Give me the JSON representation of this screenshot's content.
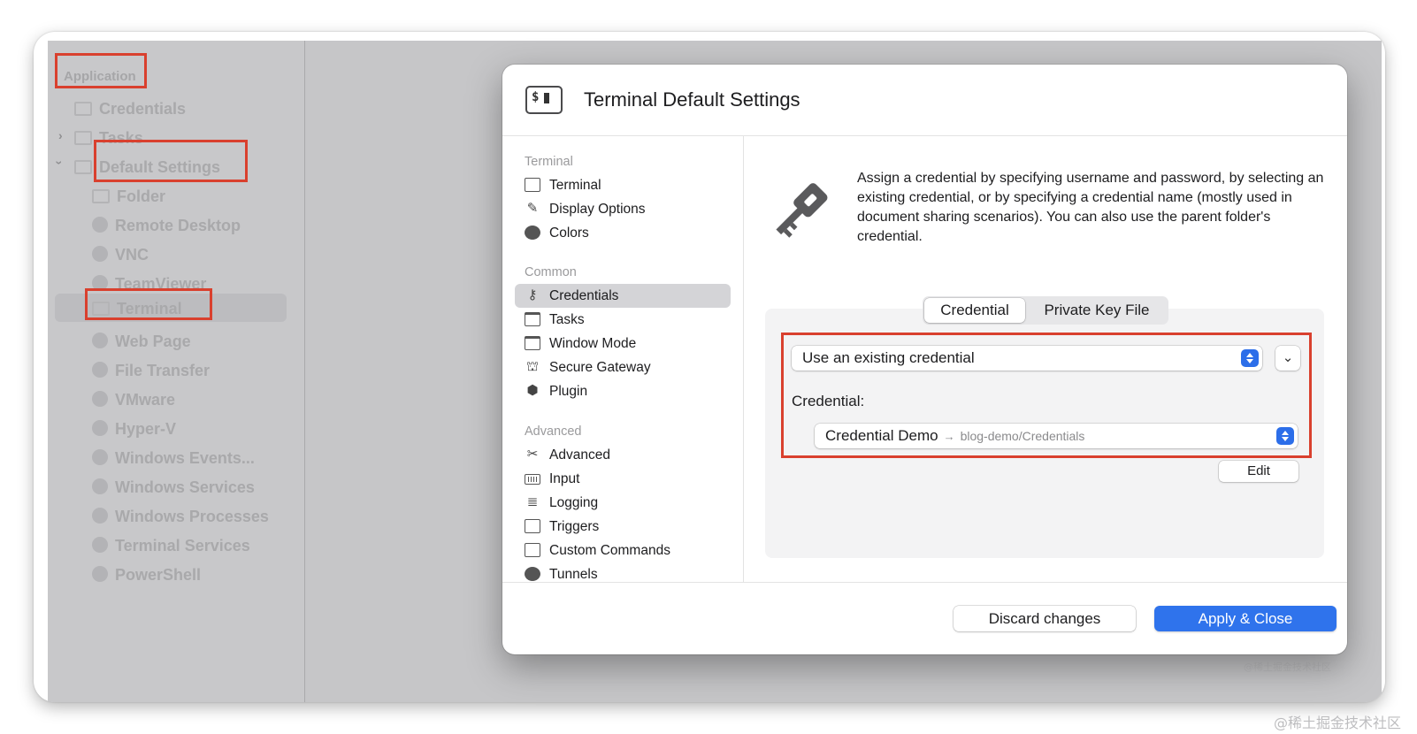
{
  "sidebar": {
    "section": "Application",
    "items": [
      {
        "label": "Credentials"
      },
      {
        "label": "Tasks"
      },
      {
        "label": "Default Settings"
      },
      {
        "label": "Folder"
      },
      {
        "label": "Remote Desktop"
      },
      {
        "label": "VNC"
      },
      {
        "label": "TeamViewer"
      },
      {
        "label": "Terminal"
      },
      {
        "label": "Web Page"
      },
      {
        "label": "File Transfer"
      },
      {
        "label": "VMware"
      },
      {
        "label": "Hyper-V"
      },
      {
        "label": "Windows Events..."
      },
      {
        "label": "Windows Services"
      },
      {
        "label": "Windows Processes"
      },
      {
        "label": "Terminal Services"
      },
      {
        "label": "PowerShell"
      }
    ]
  },
  "dialog": {
    "title": "Terminal Default Settings",
    "header_icon": "terminal-icon",
    "nav": {
      "groups": [
        {
          "label": "Terminal",
          "items": [
            {
              "label": "Terminal",
              "icon": "terminal-icon"
            },
            {
              "label": "Display Options",
              "icon": "brush-icon"
            },
            {
              "label": "Colors",
              "icon": "palette-icon"
            }
          ]
        },
        {
          "label": "Common",
          "items": [
            {
              "label": "Credentials",
              "icon": "key-icon",
              "selected": true
            },
            {
              "label": "Tasks",
              "icon": "tasks-icon"
            },
            {
              "label": "Window Mode",
              "icon": "window-icon"
            },
            {
              "label": "Secure Gateway",
              "icon": "gateway-icon"
            },
            {
              "label": "Plugin",
              "icon": "cube-icon"
            }
          ]
        },
        {
          "label": "Advanced",
          "items": [
            {
              "label": "Advanced",
              "icon": "tools-icon"
            },
            {
              "label": "Input",
              "icon": "keyboard-icon"
            },
            {
              "label": "Logging",
              "icon": "log-icon"
            },
            {
              "label": "Triggers",
              "icon": "trigger-icon"
            },
            {
              "label": "Custom Commands",
              "icon": "prompt-icon"
            },
            {
              "label": "Tunnels",
              "icon": "tunnel-icon"
            }
          ]
        }
      ]
    },
    "description": "Assign a credential by specifying username and password, by selecting an existing credential, or by specifying a credential name (mostly used in document sharing scenarios). You can also use the parent folder's credential.",
    "tabs": [
      {
        "label": "Credential",
        "active": true
      },
      {
        "label": "Private Key File",
        "active": false
      }
    ],
    "mode_popup": {
      "value": "Use an existing credential"
    },
    "credential_label": "Credential:",
    "credential_popup": {
      "name": "Credential Demo",
      "arrow": "→",
      "path": "blog-demo/Credentials"
    },
    "edit_label": "Edit",
    "discard_label": "Discard changes",
    "apply_label": "Apply & Close"
  },
  "watermark": {
    "inner": "@稀土掘金技术社区",
    "outer": "@稀土掘金技术社区"
  },
  "colors": {
    "accent": "#2f73ec",
    "annotation_red": "#d9402e"
  }
}
